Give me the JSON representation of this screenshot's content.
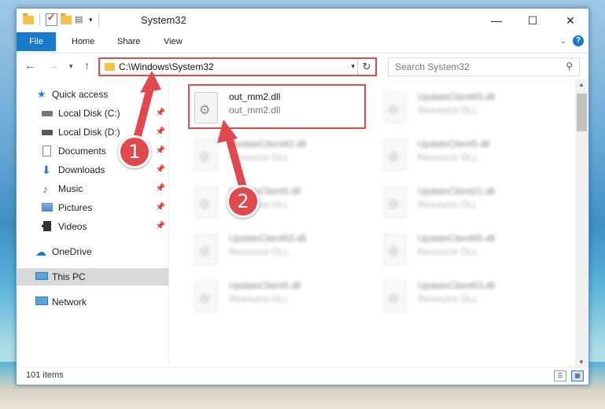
{
  "window": {
    "title": "System32",
    "controls": {
      "minimize": "—",
      "maximize": "☐",
      "close": "✕"
    }
  },
  "ribbon": {
    "tabs": [
      "File",
      "Home",
      "Share",
      "View"
    ],
    "help": "?"
  },
  "navigation": {
    "address": "C:\\Windows\\System32",
    "search_placeholder": "Search System32"
  },
  "sidebar": {
    "items": [
      {
        "label": "Quick access",
        "icon": "star-icon",
        "pinned": false
      },
      {
        "label": "Local Disk (C:)",
        "icon": "drive-icon",
        "pinned": true
      },
      {
        "label": "Local Disk (D:)",
        "icon": "drive-icon",
        "pinned": true
      },
      {
        "label": "Documents",
        "icon": "documents-icon",
        "pinned": true
      },
      {
        "label": "Downloads",
        "icon": "download-icon",
        "pinned": true
      },
      {
        "label": "Music",
        "icon": "music-icon",
        "pinned": true
      },
      {
        "label": "Pictures",
        "icon": "pictures-icon",
        "pinned": true
      },
      {
        "label": "Videos",
        "icon": "videos-icon",
        "pinned": true
      },
      {
        "label": "OneDrive",
        "icon": "cloud-icon",
        "pinned": false
      },
      {
        "label": "This PC",
        "icon": "computer-icon",
        "pinned": false,
        "selected": true
      },
      {
        "label": "Network",
        "icon": "network-icon",
        "pinned": false
      }
    ]
  },
  "files": [
    {
      "name": "out_mm2.dll",
      "type": "out_mm2.dll",
      "highlighted": true
    },
    {
      "name": "UpdateClient65.dll",
      "type": "Resource DLL"
    },
    {
      "name": "UpdateClient42.dll",
      "type": "Resource DLL"
    },
    {
      "name": "UpdateClient5.dll",
      "type": "Resource DLL"
    },
    {
      "name": "UpdateClient5.dll",
      "type": "Resource DLL"
    },
    {
      "name": "UpdateClient21.dll",
      "type": "Resource DLL"
    },
    {
      "name": "UpdateClient63.dll",
      "type": "Resource DLL"
    },
    {
      "name": "UpdateClient65.dll",
      "type": "Resource DLL"
    },
    {
      "name": "UpdateClient5.dll",
      "type": "Resource DLL"
    },
    {
      "name": "UpdateClient63.dll",
      "type": "Resource DLL"
    }
  ],
  "status": {
    "item_count": "101 items"
  },
  "annotations": {
    "step1": "1",
    "step2": "2"
  },
  "colors": {
    "accent": "#1979ca",
    "highlight": "#e0494e"
  }
}
